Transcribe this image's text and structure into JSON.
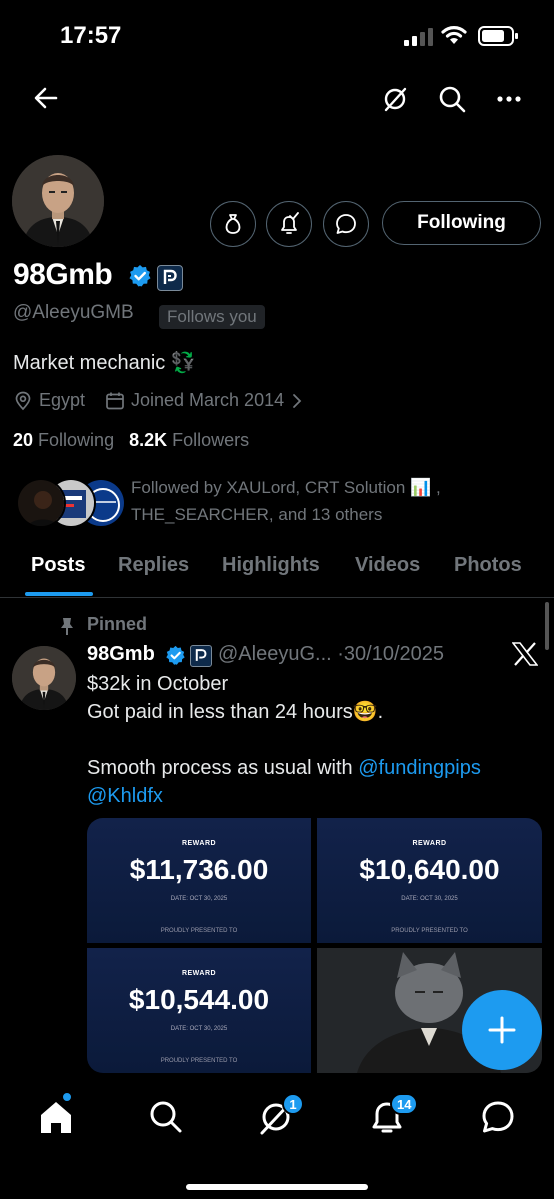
{
  "status_bar": {
    "time": "17:57"
  },
  "profile": {
    "name": "98Gmb",
    "handle": "@AleeyuGMB",
    "follows_you": "Follows you",
    "following_button": "Following",
    "bio": "Market mechanic 💱",
    "location": "Egypt",
    "joined": "Joined March 2014",
    "following_count": "20",
    "following_label": "Following",
    "followers_count": "8.2K",
    "followers_label": "Followers",
    "followed_by": "Followed by XAULord, CRT Solution 📊 , THE_SEARCHER, and 13 others"
  },
  "tabs": [
    "Posts",
    "Replies",
    "Highlights",
    "Videos",
    "Photos"
  ],
  "post": {
    "pinned_label": "Pinned",
    "name": "98Gmb",
    "handle_date": "@AleeyuG... ·30/10/2025",
    "line1": "$32k in October",
    "line2": "Got paid in less than 24 hours🤓.",
    "line3_prefix": "Smooth process as usual with ",
    "mention1": "@fundingpips",
    "mention2": "@Khldfx",
    "certificates": [
      {
        "reward": "REWARD",
        "amount": "$11,736.00",
        "date": "DATE: OCT 30, 2025",
        "presented": "PROUDLY PRESENTED TO"
      },
      {
        "reward": "REWARD",
        "amount": "$10,640.00",
        "date": "DATE: OCT 30, 2025",
        "presented": "PROUDLY PRESENTED TO"
      },
      {
        "reward": "REWARD",
        "amount": "$10,544.00",
        "date": "DATE: OCT 30, 2025",
        "presented": "PROUDLY PRESENTED TO"
      }
    ]
  },
  "bottom_nav": {
    "grok_badge": "1",
    "notifications_badge": "14"
  },
  "colors": {
    "accent": "#1d9bf0",
    "background": "#000000",
    "muted": "#71767b"
  }
}
